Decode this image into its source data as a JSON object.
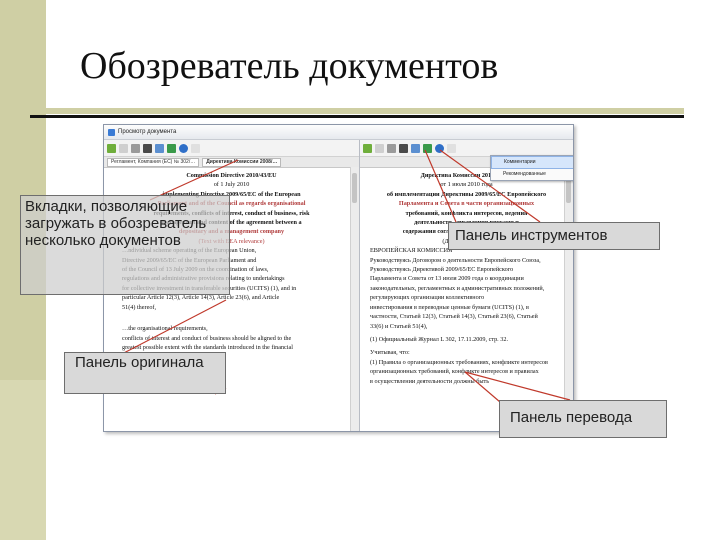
{
  "slide": {
    "title": "Обозреватель документов"
  },
  "window": {
    "title": "Просмотр документа",
    "tabs": [
      {
        "label": "Регламент, Компания (ЕС) № 302/…"
      },
      {
        "label": "Директива Комиссии 2008/…"
      }
    ],
    "menu_items": [
      {
        "label": "Комментарии"
      },
      {
        "label": "Рекомендованные"
      }
    ]
  },
  "left_doc": {
    "lines": [
      "Commission Directive 2010/43/EU",
      "of 1 July 2010",
      "implementing Directive 2009/65/EC of the European",
      "Parliament and of the Council as regards organisational",
      "requirements, conflicts of interest, conduct of business, risk",
      "management and content of the agreement between a",
      "depositary and a management company",
      "(Text with EEA relevance)",
      "…ndividual scheme operating of the European Union,",
      "Directive 2009/65/EC of the European Parliament and",
      "of the Council of 13 July 2009 on the coordination of laws,",
      "regulations and administrative provisions relating to undertakings",
      "for collective investment in transferable securities (UCITS) (1), and in",
      "particular Article 12(3), Article 14(3), Article 23(6), and Article",
      "51(4) thereof,",
      "…the organisational requirements,",
      "conflicts of interest and conduct of business should be aligned to the",
      "greatest possible extent with the standards introduced in the financial"
    ]
  },
  "right_doc": {
    "lines": [
      "Директива Комиссии 2010/43/EU",
      "от 1 июля 2010 года",
      "об имплементации Директивы 2009/65/EC Европейского",
      "Парламента и Совета в части организационных",
      "требований, конфликта интересов, ведения",
      "деятельности, управления рисками и",
      "содержания соглашения между депозитарием",
      "(Действует в ЕЭЗ)",
      "ЕВРОПЕЙСКАЯ КОМИССИЯ",
      "Руководствуясь Договором о деятельности Европейского Союза,",
      "Руководствуясь Директивой 2009/65/ЕС Европейского",
      "Парламента и Совета от 13 июля 2009 года о координации",
      "законодательных, регламентных и административных положений,",
      "регулирующих организации коллективного",
      "инвестирования в переводные ценные бумаги (UCITS) (1), в",
      "частности, Статьей 12(3), Статьей 14(3), Статьей 23(6), Статьей",
      "33(6) и Статьей 51(4),",
      "(1) Официальный Журнал L 302, 17.11.2009, стр. 32.",
      "Учитывая, что:",
      "(1) Правила о организационных требованиях, конфликте интересов",
      "организационных требований, конфликте интересов и правилах",
      "в осуществлении деятельности должны быть"
    ]
  },
  "callouts": {
    "tabs_note": "Вкладки, позволяющие загружать в обозреватель несколько документов",
    "original_panel": "Панель оригинала",
    "toolbar_panel": "Панель инструментов",
    "translation_panel": "Панель перевода"
  },
  "colors": {
    "accent_bar": "#cfcfa4",
    "callout_bg": "#d9d9d9",
    "callout_line": "#c0392b"
  }
}
